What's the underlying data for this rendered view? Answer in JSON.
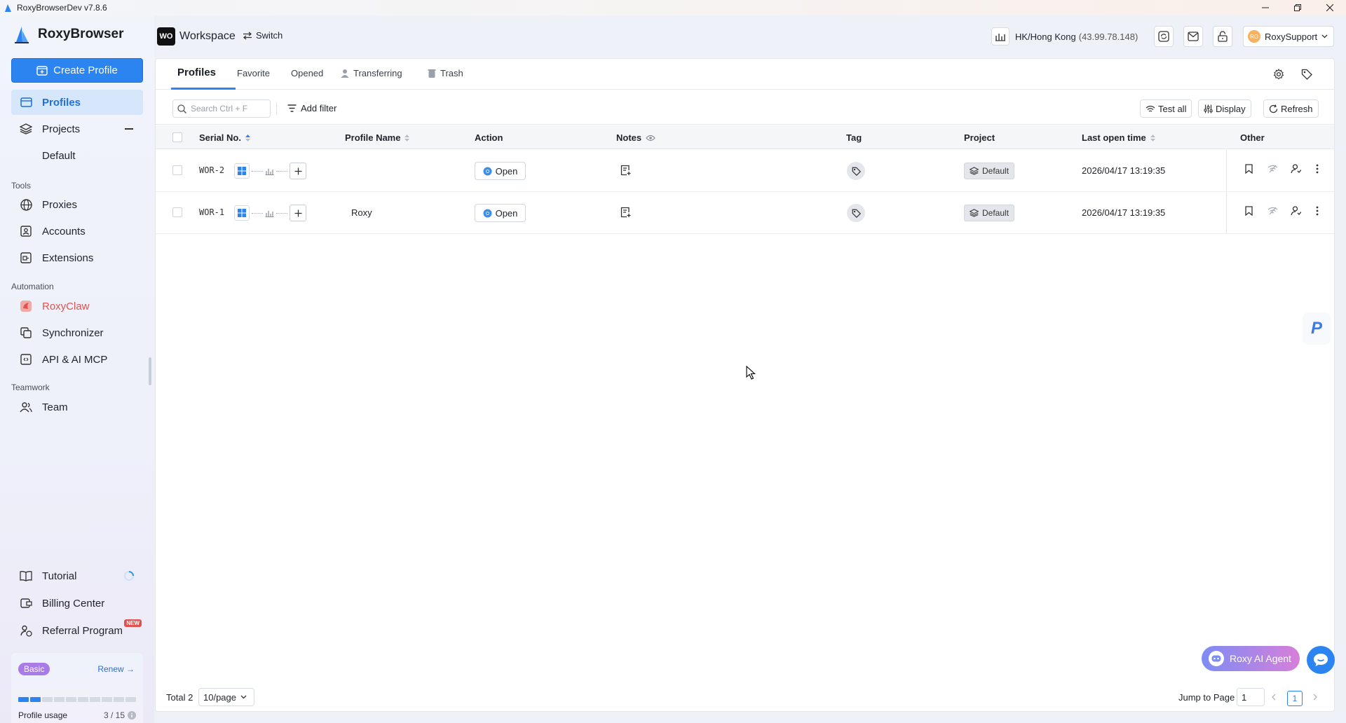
{
  "window": {
    "title": "RoxyBrowserDev v7.8.6"
  },
  "brand": {
    "name": "RoxyBrowser"
  },
  "sidebar": {
    "create_label": "Create Profile",
    "items": {
      "profiles": "Profiles",
      "projects": "Projects",
      "default": "Default",
      "proxies": "Proxies",
      "accounts": "Accounts",
      "extensions": "Extensions",
      "roxyclaw": "RoxyClaw",
      "synchronizer": "Synchronizer",
      "api": "API & AI MCP",
      "team": "Team",
      "tutorial": "Tutorial",
      "billing": "Billing Center",
      "referral": "Referral Program"
    },
    "sections": {
      "tools": "Tools",
      "automation": "Automation",
      "teamwork": "Teamwork"
    },
    "referral_badge": "NEW",
    "plan": {
      "badge": "Basic",
      "renew": "Renew →",
      "usage_label": "Profile usage",
      "usage_value": "3 / 15",
      "usage_fraction": 0.2
    }
  },
  "header": {
    "workspace_badge": "WO",
    "workspace_name": "Workspace",
    "switch_label": "Switch",
    "proxy_location": "HK/Hong Kong",
    "proxy_ip": "(43.99.78.148)",
    "user_initials": "RO",
    "user_name": "RoxySupport"
  },
  "tabs": {
    "profiles": "Profiles",
    "favorite": "Favorite",
    "opened": "Opened",
    "transferring": "Transferring",
    "trash": "Trash"
  },
  "toolbar": {
    "search_placeholder": "Search Ctrl + F",
    "add_filter": "Add filter",
    "test_all": "Test all",
    "display": "Display",
    "refresh": "Refresh"
  },
  "table": {
    "columns": {
      "serial": "Serial No.",
      "profile_name": "Profile Name",
      "action": "Action",
      "notes": "Notes",
      "tag": "Tag",
      "project": "Project",
      "last_open": "Last open time",
      "other": "Other"
    },
    "rows": [
      {
        "serial": "WOR-2",
        "name": "",
        "action": "Open",
        "project": "Default",
        "last_open": "2026/04/17 13:19:35"
      },
      {
        "serial": "WOR-1",
        "name": "Roxy",
        "action": "Open",
        "project": "Default",
        "last_open": "2026/04/17 13:19:35"
      }
    ]
  },
  "footer": {
    "total": "Total 2",
    "page_size": "10/page",
    "jump_label": "Jump to Page",
    "jump_value": "1",
    "current_page": "1"
  },
  "floating": {
    "ai_agent": "Roxy AI Agent",
    "side_letter": "P"
  },
  "colors": {
    "accent": "#2b84f0",
    "active_bg": "#d6e7fb",
    "plan_badge": "#a97be8",
    "roxyclaw": "#e0524f"
  }
}
